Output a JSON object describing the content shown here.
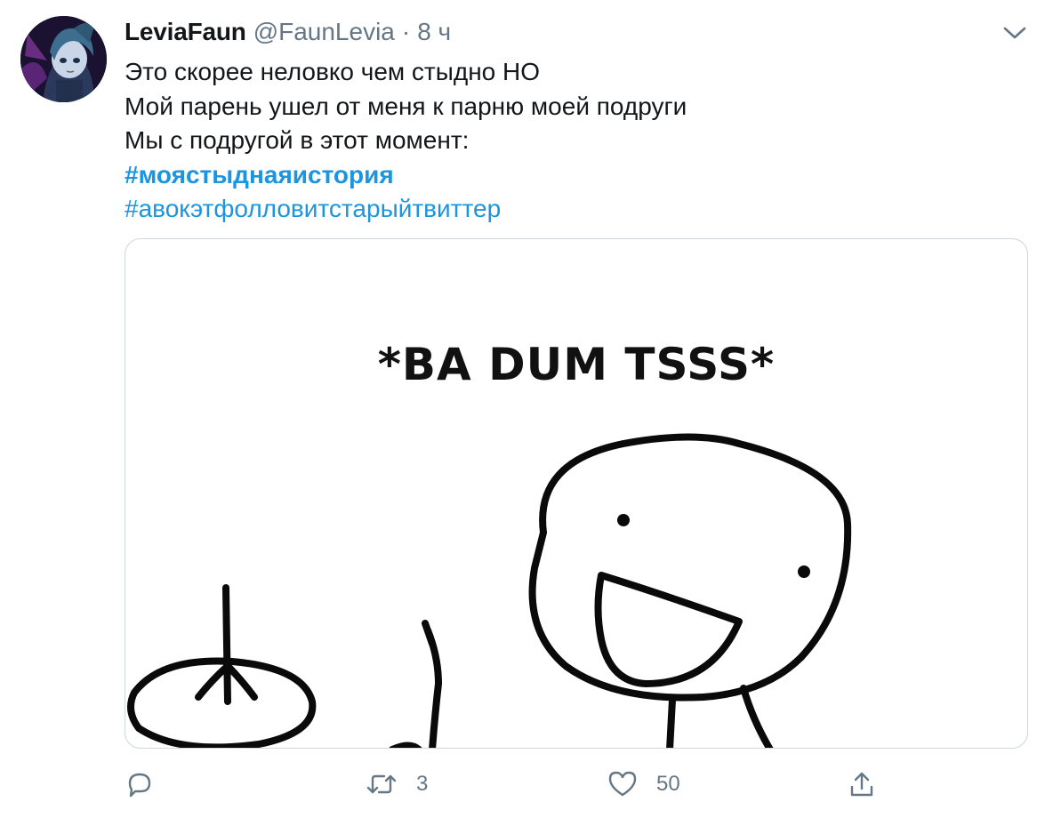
{
  "tweet": {
    "author": {
      "display_name": "LeviaFaun",
      "handle": "@FaunLevia",
      "separator": "·",
      "time": "8 ч"
    },
    "lines": [
      "Это скорее неловко чем стыдно НО",
      "Мой парень ушел от меня к парню моей подруги",
      "Мы с подругой в этот момент:"
    ],
    "hashtags": [
      "#моястыднаяистория",
      "#авокэтфолловитстарыйтвиттер"
    ],
    "media": {
      "caption": "*BA DUM TSSS*"
    },
    "actions": {
      "reply_icon": "reply-icon",
      "retweet_icon": "retweet-icon",
      "retweet_count": "3",
      "like_icon": "heart-icon",
      "like_count": "50",
      "share_icon": "share-icon"
    },
    "menu_icon": "chevron-down-icon",
    "colors": {
      "text": "#14171a",
      "secondary": "#657786",
      "link": "#1b95e0",
      "border": "#ccd6dd"
    }
  }
}
